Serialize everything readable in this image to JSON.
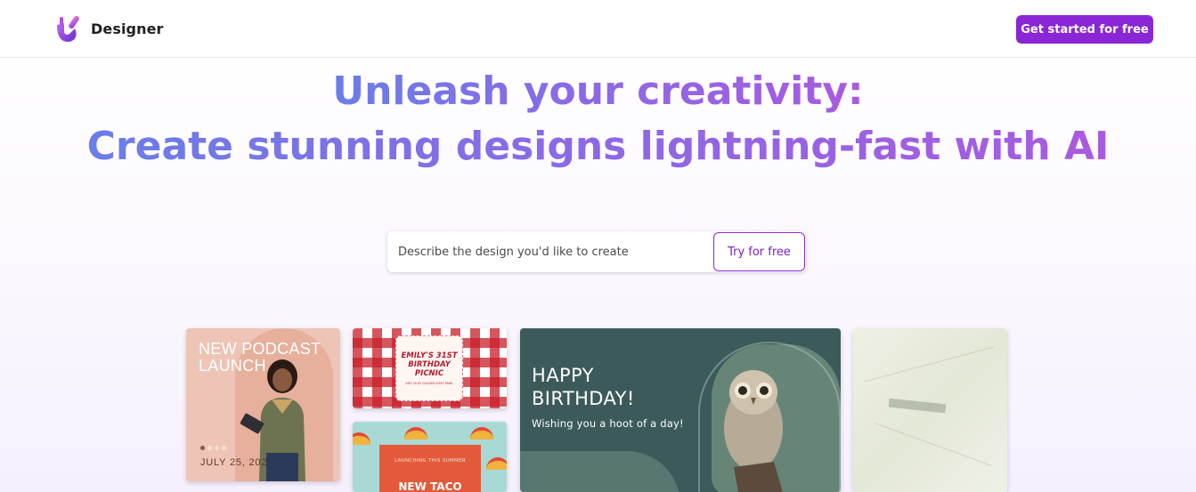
{
  "header": {
    "brand": "Designer",
    "cta_label": "Get started for free"
  },
  "hero": {
    "line1": "Unleash your creativity:",
    "line2": "Create stunning designs lightning-fast with AI"
  },
  "prompt": {
    "placeholder": "Describe the design you'd like to create",
    "button_label": "Try for free"
  },
  "gallery": {
    "podcast": {
      "title": "NEW PODCAST LAUNCH",
      "date": "JULY 25, 202"
    },
    "picnic": {
      "title": "EMILY'S 31ST BIRTHDAY PICNIC",
      "detail": "JULY 20 AT GOLDEN GATE PARK"
    },
    "taco": {
      "subtitle": "LAUNCHING THIS SUMMER",
      "title": "NEW TACO"
    },
    "birthday": {
      "title": "HAPPY BIRTHDAY!",
      "message": "Wishing you a hoot of a day!"
    }
  },
  "colors": {
    "accent": "#8a26d6",
    "hero_gradient": [
      "#6a7de8",
      "#a95ae0"
    ]
  }
}
